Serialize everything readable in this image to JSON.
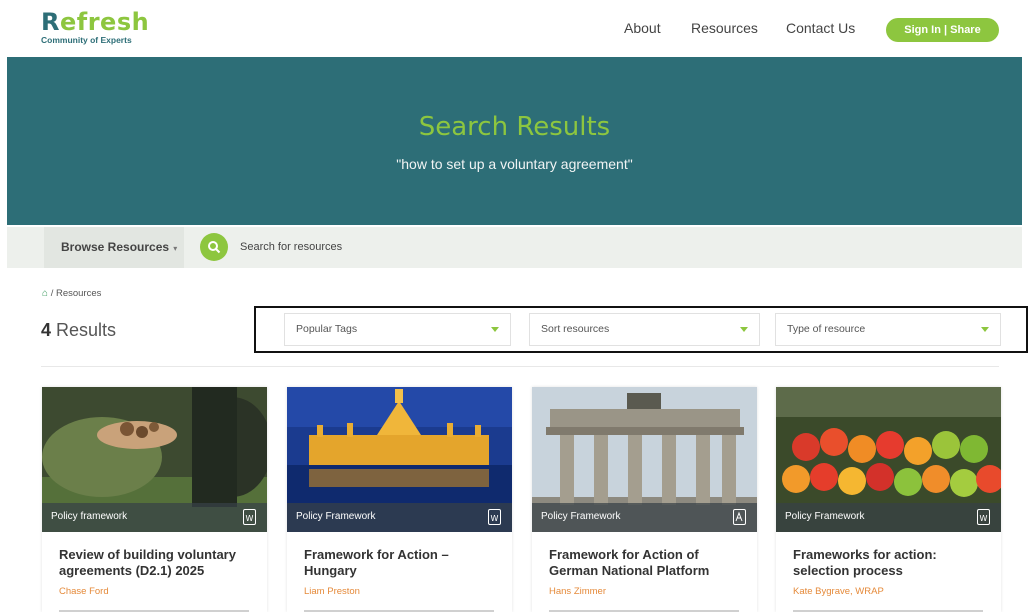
{
  "header": {
    "logo_main": "efresh",
    "logo_initial": "R",
    "logo_sub": "Community of Experts",
    "nav": [
      "About",
      "Resources",
      "Contact Us"
    ],
    "signin_label": "Sign In  |  Share"
  },
  "hero": {
    "title": "Search Results",
    "query": "\"how to set up a voluntary agreement\""
  },
  "searchbar": {
    "browse_label": "Browse Resources",
    "search_placeholder": "Search for resources",
    "search_icon": "search-icon"
  },
  "breadcrumb": {
    "home_icon": "home-icon",
    "separator": "/",
    "current": "Resources"
  },
  "results": {
    "count": "4",
    "label": " Results"
  },
  "filters": {
    "tags": "Popular Tags",
    "sort": "Sort resources",
    "type": "Type of resource"
  },
  "cards": [
    {
      "tag": "Policy framework",
      "doc_icon": "word-doc-icon",
      "title": "Review of building voluntary agreements (D2.1) 2025",
      "author": "Chase Ford"
    },
    {
      "tag": "Policy Framework",
      "doc_icon": "word-doc-icon",
      "title": "Framework for Action – Hungary",
      "author": "Liam Preston"
    },
    {
      "tag": "Policy Framework",
      "doc_icon": "pdf-doc-icon",
      "title": "Framework for Action of German National Platform",
      "author": "Hans Zimmer"
    },
    {
      "tag": "Policy Framework",
      "doc_icon": "word-doc-icon",
      "title": "Frameworks for action: selection process",
      "author": "Kate Bygrave, WRAP"
    }
  ],
  "colors": {
    "brand_green": "#8dc63f",
    "brand_teal": "#2d6e77",
    "author_orange": "#e58a3a"
  }
}
